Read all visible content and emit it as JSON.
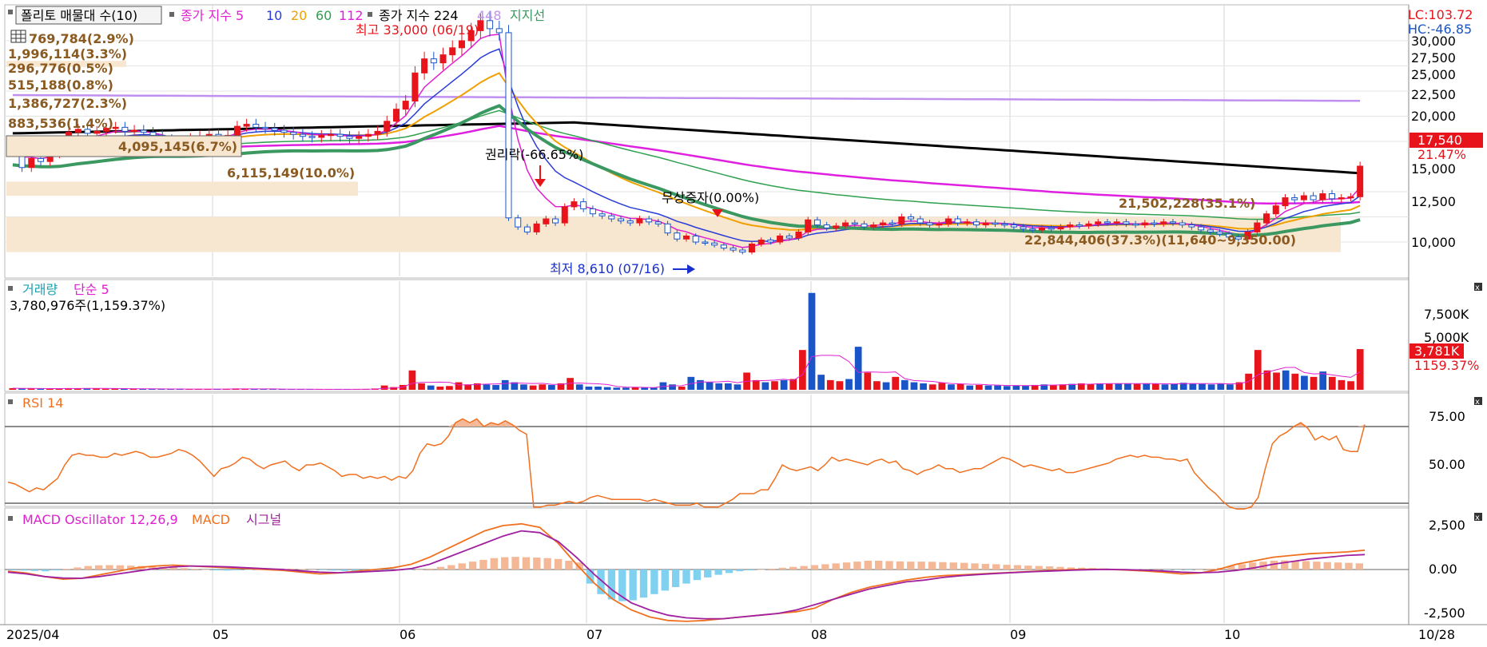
{
  "colors": {
    "up": "#e8141c",
    "down": "#1a55c8",
    "ma5": "#e020d0",
    "ma10": "#2a3cd8",
    "ma20": "#f0a000",
    "ma60": "#30a050",
    "ma112": "#e020e0",
    "ma224": "#000000",
    "ma448": "#c090f0",
    "support": "#3a9860",
    "rsi": "#f07020",
    "macd": "#f07020",
    "signal": "#a020a0",
    "osc_pos": "#f4b896",
    "osc_neg": "#80d0f0",
    "profile": "#f7e6d0"
  },
  "price_panel": {
    "legend": {
      "indicator_name": "폴리토 매물대 수(10)",
      "ma_label": "종가 지수 5",
      "ma_periods": [
        "10",
        "20",
        "60",
        "112"
      ],
      "ma_label2": "종가 지수 224",
      "ma448": "448",
      "support_label": "지지선"
    },
    "lc": "LC:103.72",
    "hc": "HC:-46.85",
    "current_price": "17,540",
    "current_change": "21.47%",
    "high_note": "최고 33,000 (06/19)",
    "low_note": "최저 8,610 (07/16)",
    "rights_note": "권리락(-66.65%)",
    "bonus_note": "무상증자(0.00%)",
    "profile_labels": [
      "769,784(2.9%)",
      "1,996,114(3.3%)",
      "296,776(0.5%)",
      "515,188(0.8%)",
      "1,386,727(2.3%)",
      "883,536(1.4%)",
      "4,095,145(6.7%)",
      "6,115,149(10.0%)",
      "21,502,228(35.1%)",
      "22,844,406(37.3%)(11,640~9,350.00)"
    ],
    "y_ticks": [
      "30,000",
      "27,500",
      "25,000",
      "22,500",
      "20,000",
      "15,000",
      "12,500",
      "10,000"
    ]
  },
  "volume_panel": {
    "legend_a": "거래량",
    "legend_b": "단순 5",
    "value": "3,780,976주(1,159.37%)",
    "y_ticks": [
      "7,500K",
      "5,000K"
    ],
    "current": "3,781K",
    "current_pct": "1159.37%"
  },
  "rsi_panel": {
    "legend": "RSI 14",
    "y_ticks": [
      "75.00",
      "50.00"
    ]
  },
  "macd_panel": {
    "legend_a": "MACD Oscillator 12,26,9",
    "legend_b": "MACD",
    "legend_c": "시그널",
    "y_ticks": [
      "2,500",
      "0.00",
      "-2,500"
    ]
  },
  "x_axis": {
    "labels": [
      "2025/04",
      "05",
      "06",
      "07",
      "08",
      "09",
      "10"
    ],
    "last_date": "10/28"
  },
  "chart_data": [
    {
      "type": "candlestick",
      "title": "",
      "ylabel": "",
      "x_labels": [
        "2025/04",
        "05",
        "06",
        "07",
        "08",
        "09",
        "10"
      ],
      "ylim": [
        8000,
        34000
      ],
      "close": [
        19000,
        17400,
        18300,
        18000,
        18800,
        19300,
        20900,
        21200,
        20800,
        21000,
        21300,
        21400,
        21000,
        21100,
        20900,
        20600,
        20200,
        19900,
        19700,
        20300,
        20500,
        20700,
        20400,
        20600,
        21500,
        21700,
        21400,
        21300,
        21100,
        20900,
        20700,
        20500,
        20400,
        20600,
        20700,
        20500,
        20300,
        20500,
        20700,
        21000,
        22000,
        23200,
        24000,
        26800,
        28200,
        27800,
        28600,
        29300,
        30000,
        31000,
        32000,
        31200,
        30800,
        12400,
        11500,
        11000,
        11800,
        12300,
        11900,
        13500,
        14000,
        13300,
        12800,
        12600,
        12300,
        12100,
        11900,
        12300,
        12000,
        11800,
        10900,
        10300,
        10600,
        10000,
        9900,
        9700,
        9400,
        9200,
        9000,
        9800,
        10200,
        10000,
        10600,
        10400,
        11000,
        12200,
        11700,
        11400,
        11600,
        11900,
        11800,
        11500,
        11700,
        11900,
        11800,
        12500,
        12300,
        11900,
        11700,
        11800,
        12300,
        11900,
        12000,
        11700,
        11900,
        11800,
        11700,
        11500,
        11300,
        11200,
        11400,
        11300,
        11500,
        11700,
        11600,
        11800,
        12000,
        11900,
        12000,
        11800,
        11700,
        11900,
        11800,
        12000,
        11900,
        11700,
        11500,
        11200,
        11000,
        10800,
        10500,
        10300,
        11000,
        11900,
        12800,
        13600,
        14400,
        14200,
        14600,
        14200,
        14800,
        14300,
        14400,
        14500,
        17540
      ]
    },
    {
      "type": "bar",
      "title": "",
      "ylabel": "",
      "ylim": [
        0,
        9500
      ],
      "values": [
        150,
        120,
        110,
        100,
        90,
        130,
        150,
        140,
        110,
        120,
        100,
        120,
        100,
        90,
        80,
        70,
        60,
        70,
        80,
        60,
        70,
        60,
        60,
        90,
        120,
        80,
        70,
        60,
        60,
        50,
        50,
        50,
        40,
        50,
        50,
        50,
        40,
        50,
        60,
        120,
        400,
        250,
        450,
        1800,
        600,
        400,
        300,
        350,
        700,
        500,
        600,
        500,
        450,
        900,
        700,
        500,
        400,
        500,
        450,
        600,
        1100,
        500,
        300,
        300,
        250,
        200,
        200,
        250,
        200,
        200,
        700,
        500,
        300,
        1200,
        900,
        700,
        600,
        600,
        500,
        1600,
        900,
        700,
        800,
        900,
        1000,
        3700,
        9000,
        1400,
        900,
        800,
        1000,
        4000,
        1600,
        800,
        700,
        1200,
        900,
        700,
        600,
        500,
        650,
        500,
        550,
        400,
        450,
        400,
        400,
        350,
        400,
        400,
        450,
        500,
        450,
        500,
        550,
        600,
        550,
        600,
        550,
        600,
        600,
        550,
        600,
        550,
        500,
        550,
        650,
        600,
        550,
        500,
        600,
        500,
        700,
        1500,
        3700,
        1800,
        1600,
        1800,
        1500,
        1300,
        1200,
        1700,
        1200,
        900,
        800,
        3781
      ]
    },
    {
      "type": "line",
      "title": "",
      "ylabel": "",
      "ylim": [
        30,
        88
      ],
      "values": [
        46,
        45,
        43,
        41,
        43,
        42,
        45,
        48,
        55,
        60,
        61,
        60,
        60,
        59,
        59,
        61,
        60,
        61,
        62,
        61,
        59,
        59,
        60,
        61,
        63,
        62,
        60,
        57,
        53,
        49,
        53,
        54,
        56,
        59,
        58,
        55,
        53,
        55,
        56,
        57,
        54,
        52,
        55,
        55,
        56,
        54,
        52,
        49,
        50,
        50,
        48,
        49,
        48,
        49,
        47,
        49,
        48,
        52,
        61,
        66,
        65,
        66,
        70,
        77,
        79,
        77,
        79,
        75,
        77,
        76,
        78,
        76,
        73,
        71,
        33,
        33,
        34,
        34,
        35,
        36,
        35,
        36,
        38,
        39,
        38,
        37,
        37,
        37,
        37,
        37,
        36,
        37,
        36,
        35,
        34,
        34,
        34,
        35,
        33,
        33,
        33,
        35,
        37,
        40,
        40,
        40,
        42,
        42,
        48,
        55,
        53,
        52,
        53,
        54,
        52,
        55,
        59,
        57,
        58,
        57,
        56,
        55,
        57,
        58,
        56,
        57,
        53,
        52,
        50,
        52,
        53,
        55,
        53,
        53,
        51,
        52,
        53,
        53,
        55,
        57,
        59,
        58,
        56,
        54,
        55,
        54,
        53,
        52,
        53,
        51,
        51,
        52,
        53,
        54,
        55,
        56,
        58,
        59,
        60,
        59,
        60,
        59,
        59,
        58,
        58,
        57,
        58,
        51,
        47,
        43,
        40,
        36,
        33,
        32,
        32,
        33,
        38,
        53,
        66,
        70,
        72,
        75,
        77,
        74,
        68,
        70,
        68,
        70,
        63,
        62,
        62,
        76
      ]
    },
    {
      "type": "bar",
      "title": "",
      "ylabel": "",
      "ylim": [
        -3300,
        3300
      ],
      "series": [
        {
          "name": "MACD Oscillator 12,26,9",
          "values": [
            -50,
            -60,
            -80,
            -100,
            -50,
            40,
            120,
            200,
            240,
            250,
            240,
            220,
            200,
            180,
            150,
            120,
            80,
            40,
            0,
            -50,
            -60,
            -40,
            -20,
            20,
            50,
            60,
            50,
            30,
            0,
            -30,
            -60,
            -80,
            -100,
            -90,
            -80,
            -60,
            -40,
            -20,
            0,
            50,
            150,
            250,
            350,
            450,
            550,
            650,
            700,
            720,
            700,
            680,
            650,
            600,
            500,
            400,
            -800,
            -1400,
            -1700,
            -1800,
            -1750,
            -1600,
            -1400,
            -1200,
            -1000,
            -800,
            -600,
            -450,
            -300,
            -200,
            -100,
            -50,
            0,
            50,
            100,
            150,
            200,
            250,
            300,
            350,
            400,
            450,
            500,
            500,
            480,
            460,
            450,
            450,
            440,
            420,
            400,
            380,
            350,
            320,
            300,
            270,
            250,
            220,
            200,
            180,
            150,
            120,
            100,
            80,
            60,
            40,
            30,
            20,
            10,
            0,
            -10,
            -20,
            -30,
            0,
            50,
            100,
            200,
            300,
            400,
            450,
            500,
            520,
            500,
            480,
            450,
            420,
            400,
            380,
            350
          ]
        },
        {
          "name": "MACD",
          "values": [
            -100,
            -200,
            -400,
            -550,
            -500,
            -300,
            -100,
            100,
            200,
            250,
            200,
            150,
            100,
            50,
            0,
            -50,
            -150,
            -250,
            -200,
            -100,
            0,
            100,
            300,
            700,
            1200,
            1700,
            2200,
            2500,
            2600,
            2400,
            1500,
            300,
            -800,
            -1700,
            -2300,
            -2700,
            -2900,
            -2950,
            -2900,
            -2800,
            -2700,
            -2600,
            -2500,
            -2400,
            -2200,
            -1700,
            -1300,
            -1000,
            -800,
            -600,
            -450,
            -350,
            -300,
            -250,
            -200,
            -150,
            -100,
            -50,
            0,
            20,
            10,
            -30,
            -80,
            -150,
            -250,
            -200,
            0,
            300,
            500,
            700,
            800,
            900,
            950,
            1000,
            1100
          ]
        },
        {
          "name": "시그널",
          "values": [
            -150,
            -250,
            -400,
            -480,
            -500,
            -400,
            -250,
            -100,
            50,
            150,
            200,
            180,
            150,
            100,
            50,
            0,
            -80,
            -150,
            -180,
            -150,
            -100,
            -50,
            50,
            300,
            700,
            1100,
            1500,
            1900,
            2200,
            2100,
            1600,
            700,
            -300,
            -1200,
            -1900,
            -2300,
            -2600,
            -2750,
            -2800,
            -2800,
            -2700,
            -2600,
            -2500,
            -2300,
            -2000,
            -1700,
            -1400,
            -1100,
            -900,
            -700,
            -600,
            -450,
            -350,
            -280,
            -220,
            -170,
            -120,
            -80,
            -40,
            -10,
            10,
            -10,
            -40,
            -80,
            -150,
            -180,
            -150,
            -50,
            100,
            300,
            450,
            600,
            700,
            800,
            850
          ]
        }
      ]
    }
  ]
}
